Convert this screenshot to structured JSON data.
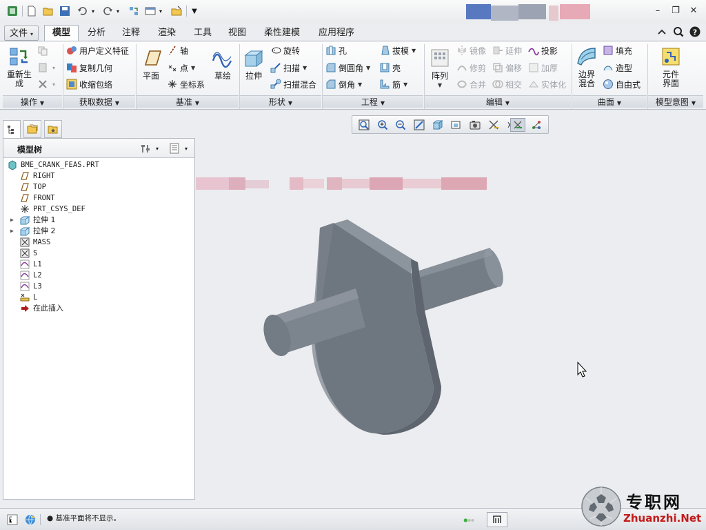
{
  "titlebar": {
    "quick_access": [
      "app-icon",
      "new-icon",
      "open-icon",
      "save-icon",
      "undo-icon",
      "redo-icon",
      "regenerate-icon",
      "window-icon",
      "close-window-icon",
      "customize-icon"
    ],
    "window_buttons": {
      "minimize": "–",
      "restore": "❐",
      "close": "✕"
    }
  },
  "tabs": [
    "文件",
    "模型",
    "分析",
    "注释",
    "渲染",
    "工具",
    "视图",
    "柔性建模",
    "应用程序"
  ],
  "active_tab": "模型",
  "ribbon": {
    "groups": {
      "operations": "操作",
      "get_data": "获取数据",
      "datum": "基准",
      "shapes": "形状",
      "engineering": "工程",
      "editing": "编辑",
      "surfaces": "曲面",
      "model_intent": "模型意图"
    },
    "operations": {
      "regenerate_line1": "重新生",
      "regenerate_line2": "成"
    },
    "get_data": {
      "udf": "用户定义特征",
      "copy_geom": "复制几何",
      "shrinkwrap": "收缩包络"
    },
    "datum": {
      "plane": "平面",
      "axis": "轴",
      "point": "点",
      "csys": "坐标系",
      "sketch": "草绘"
    },
    "shapes": {
      "extrude": "拉伸",
      "revolve": "旋转",
      "sweep": "扫描",
      "swept_blend": "扫描混合"
    },
    "engineering": {
      "hole": "孔",
      "round": "倒圆角",
      "chamfer": "倒角",
      "draft": "拔模",
      "shell": "壳",
      "rib": "筋"
    },
    "editing": {
      "pattern": "阵列",
      "mirror": "镜像",
      "trim": "修剪",
      "merge": "合并",
      "extend": "延伸",
      "offset": "偏移",
      "intersect": "相交",
      "project": "投影",
      "thicken": "加厚",
      "solidify": "实体化"
    },
    "surfaces": {
      "boundary_line1": "边界",
      "boundary_line2": "混合",
      "fill": "填充",
      "style": "造型",
      "freestyle": "自由式"
    },
    "model_intent": {
      "component_interface_line1": "元件",
      "component_interface_line2": "界面"
    }
  },
  "model_tree": {
    "title": "模型树",
    "items": [
      {
        "label": "BME_CRANK_FEAS.PRT",
        "icon": "part-icon",
        "indent": 0,
        "expandable": false
      },
      {
        "label": "RIGHT",
        "icon": "datum-plane-icon",
        "indent": 1,
        "expandable": false
      },
      {
        "label": "TOP",
        "icon": "datum-plane-icon",
        "indent": 1,
        "expandable": false
      },
      {
        "label": "FRONT",
        "icon": "datum-plane-icon",
        "indent": 1,
        "expandable": false
      },
      {
        "label": "PRT_CSYS_DEF",
        "icon": "csys-icon",
        "indent": 1,
        "expandable": false
      },
      {
        "label": "拉伸 1",
        "icon": "extrude-icon",
        "indent": 1,
        "expandable": true
      },
      {
        "label": "拉伸 2",
        "icon": "extrude-icon",
        "indent": 1,
        "expandable": true
      },
      {
        "label": "MASS",
        "icon": "analysis-icon",
        "indent": 1,
        "expandable": false
      },
      {
        "label": "S",
        "icon": "analysis-icon",
        "indent": 1,
        "expandable": false
      },
      {
        "label": "L1",
        "icon": "curve-analysis-icon",
        "indent": 1,
        "expandable": false
      },
      {
        "label": "L2",
        "icon": "curve-analysis-icon",
        "indent": 1,
        "expandable": false
      },
      {
        "label": "L3",
        "icon": "curve-analysis-icon",
        "indent": 1,
        "expandable": false
      },
      {
        "label": "L",
        "icon": "measure-icon",
        "indent": 1,
        "expandable": false
      },
      {
        "label": "在此插入",
        "icon": "insert-arrow-icon",
        "indent": 1,
        "expandable": false
      }
    ]
  },
  "view_toolbar": [
    "refit-icon",
    "zoom-in-icon",
    "zoom-out-icon",
    "repaint-icon",
    "display-style-icon",
    "saved-views-icon",
    "view-manager-icon",
    "perspective-icon",
    "datum-display-icon",
    "annotation-display-icon",
    "spin-center-icon"
  ],
  "status": {
    "message": "基准平面将不显示。"
  },
  "watermark": {
    "cn": "专职网",
    "url": "Zhuanzhi.Net"
  },
  "colors": {
    "model_gray": "#808891",
    "accent_blue": "#2f63b8",
    "status_green": "#3cb043"
  }
}
